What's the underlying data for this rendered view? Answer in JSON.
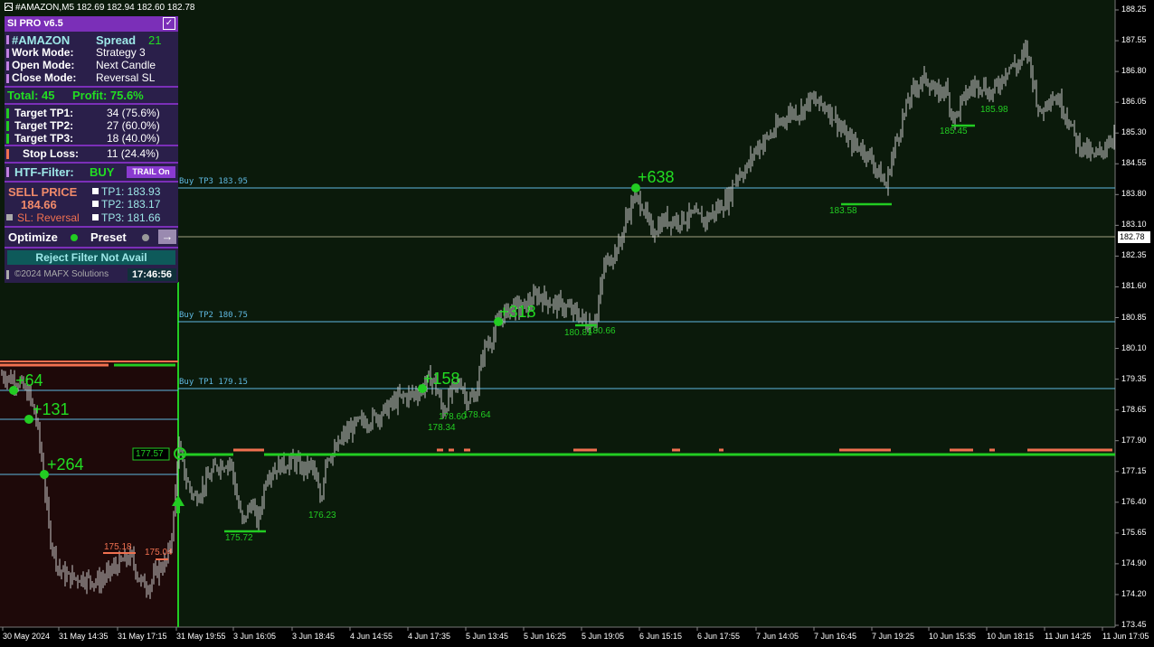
{
  "window": {
    "symbol_bar": "#AMAZON,M5  182.69 182.94 182.60 182.78"
  },
  "panel": {
    "title": "SI PRO v6.5",
    "symbol": "#AMAZON",
    "spread_label": "Spread",
    "spread_value": "21",
    "work_mode_label": "Work  Mode:",
    "work_mode_value": "Strategy 3",
    "open_mode_label": "Open  Mode:",
    "open_mode_value": "Next Candle",
    "close_mode_label": "Close Mode:",
    "close_mode_value": "Reversal SL",
    "total": "Total: 45",
    "profit": "Profit: 75.6%",
    "tp1_label": "Target TP1:",
    "tp1_value": "34 (75.6%)",
    "tp2_label": "Target TP2:",
    "tp2_value": "27 (60.0%)",
    "tp3_label": "Target TP3:",
    "tp3_value": "18 (40.0%)",
    "sl_label": "Stop Loss:",
    "sl_value": "11 (24.4%)",
    "htf_label": "HTF-Filter:",
    "htf_value": "BUY",
    "trail_button": "TRAIL On",
    "sell_price_label": "SELL PRICE",
    "sell_price_value": "184.66",
    "sl_reversal": "SL: Reversal",
    "tp1_price": "TP1: 183.93",
    "tp2_price": "TP2: 183.17",
    "tp3_price": "TP3: 181.66",
    "optimize_label": "Optimize",
    "preset_label": "Preset",
    "preset_arrow": "→",
    "reject_filter": "Reject Filter Not Avail",
    "copyright": "©2024 MAFX Solutions",
    "clock": "17:46:56"
  },
  "colors": {
    "background": "#000000",
    "chart_area": "#0b1a0b",
    "sell_zone": "#1e0909",
    "candle": "#c8c8c8",
    "buy_green": "#22cc22",
    "sell_red": "#f07050",
    "tp_line": "#5fb8e0",
    "panel_bg": "#2a1f4a",
    "panel_title": "#7b2fb8"
  },
  "levels": {
    "tp3_label": "Buy TP3 183.95",
    "tp2_label": "Buy TP2 180.75",
    "tp1_label": "Buy TP1 179.15",
    "entry_box": "177.57",
    "current_price": "182.78"
  },
  "annotations": {
    "p638": "+638",
    "p318": "+318",
    "p158": "+158",
    "p64": "+64",
    "p131": "+131",
    "p264": "+264",
    "low_175_72": "175.72",
    "low_176_23": "176.23",
    "low_178_34": "178.34",
    "low_178_60": "178.60",
    "low_178_64": "178.64",
    "low_180_81": "180.81",
    "low_180_66": "180.66",
    "low_183_58": "183.58",
    "low_185_45": "185.45",
    "low_185_98": "185.98",
    "high_175_18": "175.18",
    "high_175_04": "175.04"
  },
  "y_axis": [
    "188.25",
    "187.55",
    "186.80",
    "186.05",
    "185.30",
    "184.55",
    "183.80",
    "183.10",
    "182.35",
    "181.60",
    "180.85",
    "180.10",
    "179.35",
    "178.65",
    "177.90",
    "177.15",
    "176.40",
    "175.65",
    "174.90",
    "174.20",
    "173.45"
  ],
  "x_axis": [
    "30 May 2024",
    "31 May 14:35",
    "31 May 17:15",
    "31 May 19:55",
    "3 Jun 16:05",
    "3 Jun 18:45",
    "4 Jun 14:55",
    "4 Jun 17:35",
    "5 Jun 13:45",
    "5 Jun 16:25",
    "5 Jun 19:05",
    "6 Jun 15:15",
    "6 Jun 17:55",
    "7 Jun 14:05",
    "7 Jun 16:45",
    "7 Jun 19:25",
    "10 Jun 15:35",
    "10 Jun 18:15",
    "11 Jun 14:25",
    "11 Jun 17:05"
  ],
  "chart_data": {
    "type": "line",
    "title": "#AMAZON,M5",
    "price_range": [
      173.2,
      188.4
    ],
    "close_anchors": [
      [
        0,
        179.5
      ],
      [
        20,
        179.3
      ],
      [
        32,
        179.0
      ],
      [
        40,
        178.4
      ],
      [
        47,
        177.3
      ],
      [
        55,
        175.6
      ],
      [
        65,
        174.8
      ],
      [
        75,
        174.6
      ],
      [
        90,
        174.6
      ],
      [
        110,
        174.5
      ],
      [
        130,
        174.9
      ],
      [
        145,
        175.1
      ],
      [
        155,
        174.5
      ],
      [
        165,
        174.4
      ],
      [
        175,
        174.8
      ],
      [
        185,
        175.0
      ],
      [
        192,
        176.0
      ],
      [
        197,
        177.8
      ],
      [
        205,
        177.0
      ],
      [
        215,
        176.5
      ],
      [
        225,
        176.8
      ],
      [
        240,
        177.3
      ],
      [
        255,
        177.4
      ],
      [
        262,
        176.5
      ],
      [
        268,
        175.9
      ],
      [
        278,
        176.4
      ],
      [
        285,
        175.9
      ],
      [
        295,
        177.1
      ],
      [
        310,
        177.3
      ],
      [
        325,
        177.4
      ],
      [
        335,
        177.2
      ],
      [
        345,
        177.3
      ],
      [
        355,
        176.4
      ],
      [
        360,
        177.5
      ],
      [
        370,
        177.6
      ],
      [
        380,
        178.0
      ],
      [
        395,
        178.3
      ],
      [
        410,
        178.4
      ],
      [
        425,
        178.6
      ],
      [
        440,
        178.9
      ],
      [
        455,
        179.0
      ],
      [
        465,
        179.1
      ],
      [
        475,
        179.4
      ],
      [
        480,
        179.3
      ],
      [
        490,
        178.6
      ],
      [
        500,
        179.1
      ],
      [
        510,
        179.3
      ],
      [
        515,
        178.9
      ],
      [
        525,
        178.9
      ],
      [
        535,
        180.1
      ],
      [
        545,
        180.4
      ],
      [
        552,
        180.8
      ],
      [
        565,
        181.1
      ],
      [
        580,
        181.1
      ],
      [
        595,
        181.4
      ],
      [
        610,
        181.2
      ],
      [
        625,
        181.1
      ],
      [
        640,
        180.9
      ],
      [
        650,
        180.7
      ],
      [
        660,
        180.9
      ],
      [
        668,
        182.1
      ],
      [
        675,
        182.3
      ],
      [
        685,
        182.6
      ],
      [
        692,
        183.2
      ],
      [
        700,
        183.7
      ],
      [
        710,
        183.6
      ],
      [
        720,
        182.9
      ],
      [
        735,
        183.2
      ],
      [
        750,
        183.2
      ],
      [
        765,
        183.3
      ],
      [
        780,
        183.2
      ],
      [
        795,
        183.5
      ],
      [
        805,
        183.7
      ],
      [
        815,
        184.3
      ],
      [
        825,
        184.4
      ],
      [
        835,
        184.9
      ],
      [
        845,
        185.1
      ],
      [
        855,
        185.3
      ],
      [
        865,
        185.6
      ],
      [
        875,
        185.8
      ],
      [
        885,
        185.8
      ],
      [
        895,
        186.1
      ],
      [
        905,
        186.0
      ],
      [
        915,
        185.9
      ],
      [
        925,
        185.6
      ],
      [
        935,
        185.2
      ],
      [
        945,
        185.0
      ],
      [
        955,
        184.9
      ],
      [
        965,
        184.6
      ],
      [
        975,
        184.2
      ],
      [
        980,
        184.0
      ],
      [
        985,
        184.6
      ],
      [
        995,
        185.4
      ],
      [
        1005,
        186.1
      ],
      [
        1015,
        186.5
      ],
      [
        1025,
        186.6
      ],
      [
        1035,
        186.2
      ],
      [
        1045,
        186.4
      ],
      [
        1055,
        185.6
      ],
      [
        1065,
        186.1
      ],
      [
        1075,
        186.4
      ],
      [
        1085,
        186.5
      ],
      [
        1095,
        186.2
      ],
      [
        1105,
        186.5
      ],
      [
        1115,
        186.9
      ],
      [
        1125,
        186.9
      ],
      [
        1135,
        187.3
      ],
      [
        1142,
        186.6
      ],
      [
        1150,
        185.7
      ],
      [
        1160,
        186.2
      ],
      [
        1170,
        186.1
      ],
      [
        1180,
        185.7
      ],
      [
        1190,
        185.1
      ],
      [
        1200,
        184.9
      ],
      [
        1210,
        184.7
      ],
      [
        1220,
        184.9
      ],
      [
        1232,
        185.3
      ]
    ]
  }
}
